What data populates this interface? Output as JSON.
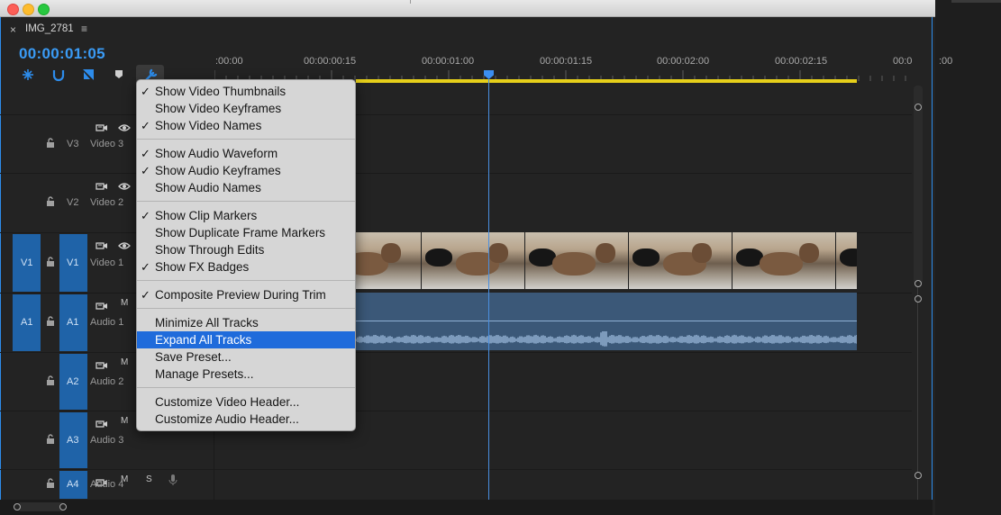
{
  "window": {
    "title": ""
  },
  "tab": {
    "close": "×",
    "name": "IMG_2781",
    "menu": "≡"
  },
  "timecode": "00:00:01:05",
  "ruler": {
    "labels": [
      ":00:00",
      "00:00:00:15",
      "00:00:01:00",
      "00:00:01:15",
      "00:00:02:00",
      "00:00:02:15",
      "00:0",
      ":00"
    ]
  },
  "tracks": [
    {
      "source": "",
      "id": "V3",
      "name": "Video 3",
      "kind": "video"
    },
    {
      "source": "",
      "id": "V2",
      "name": "Video 2",
      "kind": "video"
    },
    {
      "source": "V1",
      "id": "V1",
      "name": "Video 1",
      "kind": "video"
    },
    {
      "source": "A1",
      "id": "A1",
      "name": "Audio 1",
      "kind": "audio"
    },
    {
      "source": "",
      "id": "A2",
      "name": "Audio 2",
      "kind": "audio"
    },
    {
      "source": "",
      "id": "A3",
      "name": "Audio 3",
      "kind": "audio"
    },
    {
      "source": "",
      "id": "A4",
      "name": "Audio 4",
      "kind": "audio"
    }
  ],
  "track_controls": {
    "mute": "M",
    "solo": "S"
  },
  "menu": {
    "items": [
      {
        "label": "Show Video Thumbnails",
        "checked": "✓"
      },
      {
        "label": "Show Video Keyframes",
        "checked": ""
      },
      {
        "label": "Show Video Names",
        "checked": "✓"
      },
      {
        "label": "Show Audio Waveform",
        "checked": "✓"
      },
      {
        "label": "Show Audio Keyframes",
        "checked": "✓"
      },
      {
        "label": "Show Audio Names",
        "checked": ""
      },
      {
        "label": "Show Clip Markers",
        "checked": "✓"
      },
      {
        "label": "Show Duplicate Frame Markers",
        "checked": ""
      },
      {
        "label": "Show Through Edits",
        "checked": ""
      },
      {
        "label": "Show FX Badges",
        "checked": "✓"
      },
      {
        "label": "Composite Preview During Trim",
        "checked": "✓"
      },
      {
        "label": "Minimize All Tracks",
        "checked": ""
      },
      {
        "label": "Expand All Tracks",
        "checked": "",
        "selected": true
      },
      {
        "label": "Save Preset...",
        "checked": ""
      },
      {
        "label": "Manage Presets...",
        "checked": ""
      },
      {
        "label": "Customize Video Header...",
        "checked": ""
      },
      {
        "label": "Customize Audio Header...",
        "checked": ""
      }
    ]
  },
  "colors": {
    "accent": "#2d8ceb",
    "inout_bar": "#e6cf1a",
    "selected_item": "#1f6bdb",
    "source_patch": "#1f63a8"
  },
  "icons": [
    "snap-icon",
    "linked-selection-icon",
    "add-marker-icon",
    "marker-icon",
    "wrench-icon",
    "lock-icon",
    "camera-icon",
    "eye-icon",
    "mic-icon"
  ]
}
